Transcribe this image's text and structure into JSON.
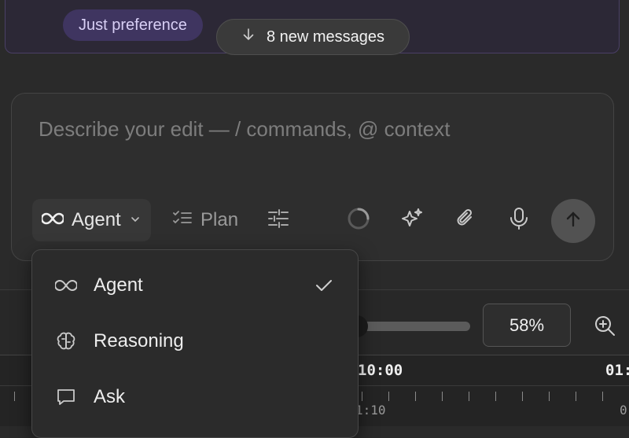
{
  "messages": {
    "chip_label": "Just preference",
    "new_messages_label": "8 new messages"
  },
  "composer": {
    "placeholder_text": "Describe your edit —  /  commands,  @  context",
    "mode_label": "Agent",
    "plan_label": "Plan"
  },
  "mode_menu": {
    "items": [
      {
        "label": "Agent",
        "icon": "infinity-icon",
        "selected": true
      },
      {
        "label": "Reasoning",
        "icon": "brain-icon",
        "selected": false
      },
      {
        "label": "Ask",
        "icon": "chat-icon",
        "selected": false
      }
    ]
  },
  "zoom": {
    "value": "58%",
    "slider_fraction": 0.58
  },
  "timeline": {
    "major_labels": [
      "10:00",
      "01:"
    ],
    "minor_labels": [
      "1:10",
      "0"
    ]
  },
  "colors": {
    "background": "#2a2a2a",
    "accent_purple": "#3f3560",
    "send_button": "#525252"
  }
}
